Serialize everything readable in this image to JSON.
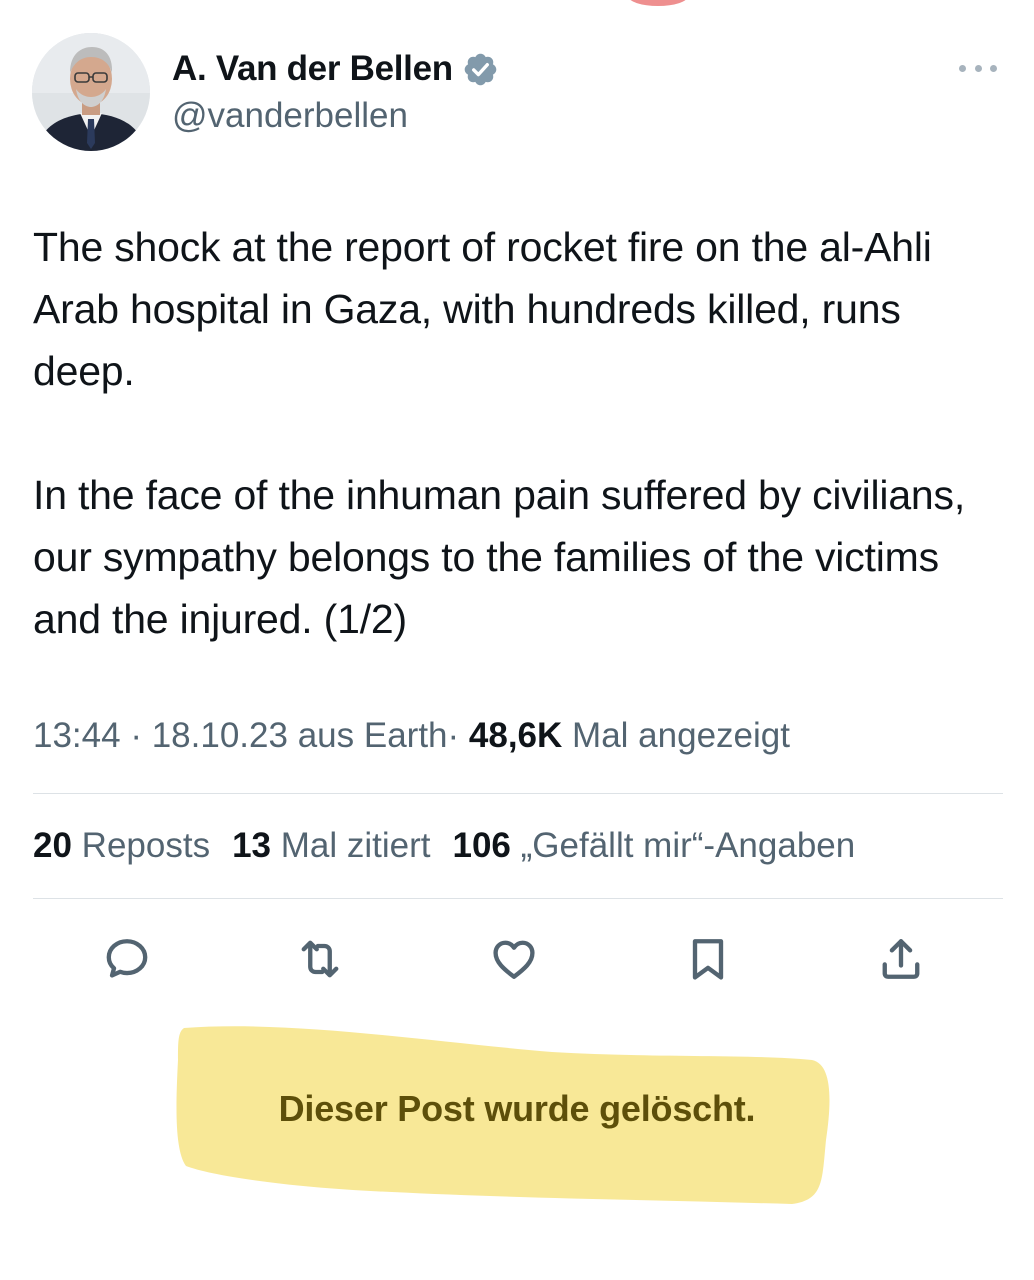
{
  "author": {
    "display_name": "A. Van der Bellen",
    "handle": "@vanderbellen",
    "verified": true
  },
  "icons": {
    "verified": "verified-badge-icon",
    "more": "more-options-icon",
    "reply": "reply-icon",
    "repost": "repost-icon",
    "like": "like-icon",
    "bookmark": "bookmark-icon",
    "share": "share-icon"
  },
  "tweet": {
    "paragraph_1": "The shock at the report of rocket fire on the al-Ahli Arab hospital in Gaza, with hundreds killed, runs deep.",
    "paragraph_2": "In the face of the inhuman pain suffered by civilians, our sympathy belongs to the families of the victims and the injured. (1/2)"
  },
  "meta": {
    "time": "13:44",
    "date": "18.10.23",
    "source": "aus Earth",
    "sep": "·",
    "views_count": "48,6K",
    "views_label": "Mal angezeigt"
  },
  "stats": {
    "reposts_count": "20",
    "reposts_label": "Reposts",
    "quotes_count": "13",
    "quotes_label": "Mal zitiert",
    "likes_count": "106",
    "likes_label": "„Gefällt mir“-Angaben"
  },
  "notice": {
    "text": "Dieser Post wurde gelöscht."
  },
  "colors": {
    "text_primary": "#0f1419",
    "text_secondary": "#536471",
    "verified_badge": "#829aab",
    "highlight": "#f6e27a",
    "notice_text": "#5d4f0a"
  }
}
